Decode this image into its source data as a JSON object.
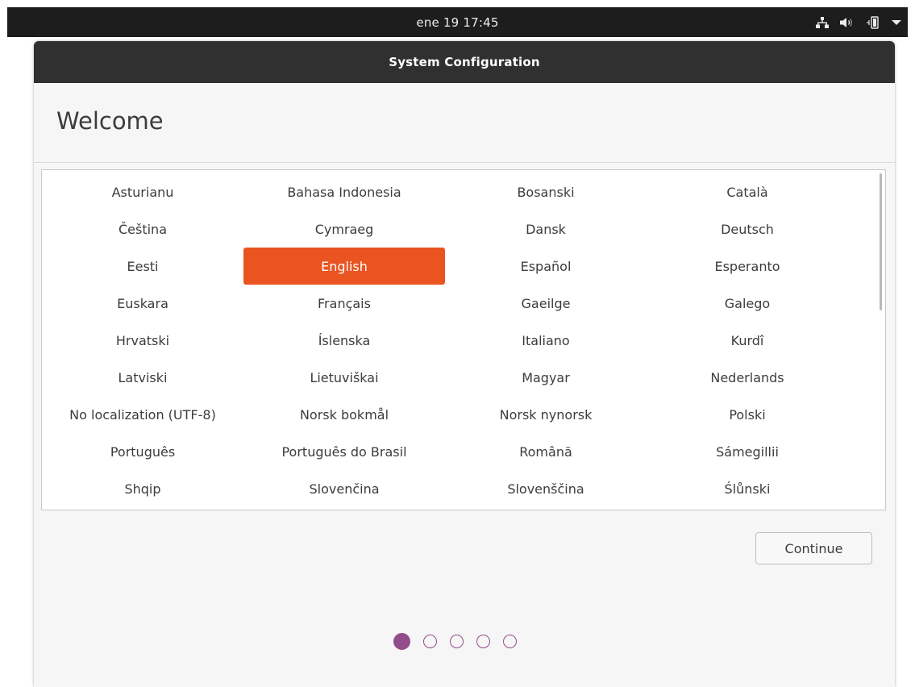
{
  "topbar": {
    "clock": "ene 19  17:45",
    "icons": [
      "network-icon",
      "volume-icon",
      "battery-icon",
      "chevron-down-icon"
    ]
  },
  "window": {
    "title": "System Configuration",
    "heading": "Welcome"
  },
  "languages": [
    "Asturianu",
    "Bahasa Indonesia",
    "Bosanski",
    "Català",
    "Čeština",
    "Cymraeg",
    "Dansk",
    "Deutsch",
    "Eesti",
    "English",
    "Español",
    "Esperanto",
    "Euskara",
    "Français",
    "Gaeilge",
    "Galego",
    "Hrvatski",
    "Íslenska",
    "Italiano",
    "Kurdî",
    "Latviski",
    "Lietuviškai",
    "Magyar",
    "Nederlands",
    "No localization (UTF-8)",
    "Norsk bokmål",
    "Norsk nynorsk",
    "Polski",
    "Português",
    "Português do Brasil",
    "Română",
    "Sámegillii",
    "Shqip",
    "Slovenčina",
    "Slovenščina",
    "Ślůnski"
  ],
  "selected_language": "English",
  "buttons": {
    "continue_label": "Continue"
  },
  "pager": {
    "total": 5,
    "current": 1
  },
  "colors": {
    "accent": "#e95420",
    "pager": "#924d8b",
    "titlebar": "#303030",
    "topbar": "#1d1d1d"
  }
}
